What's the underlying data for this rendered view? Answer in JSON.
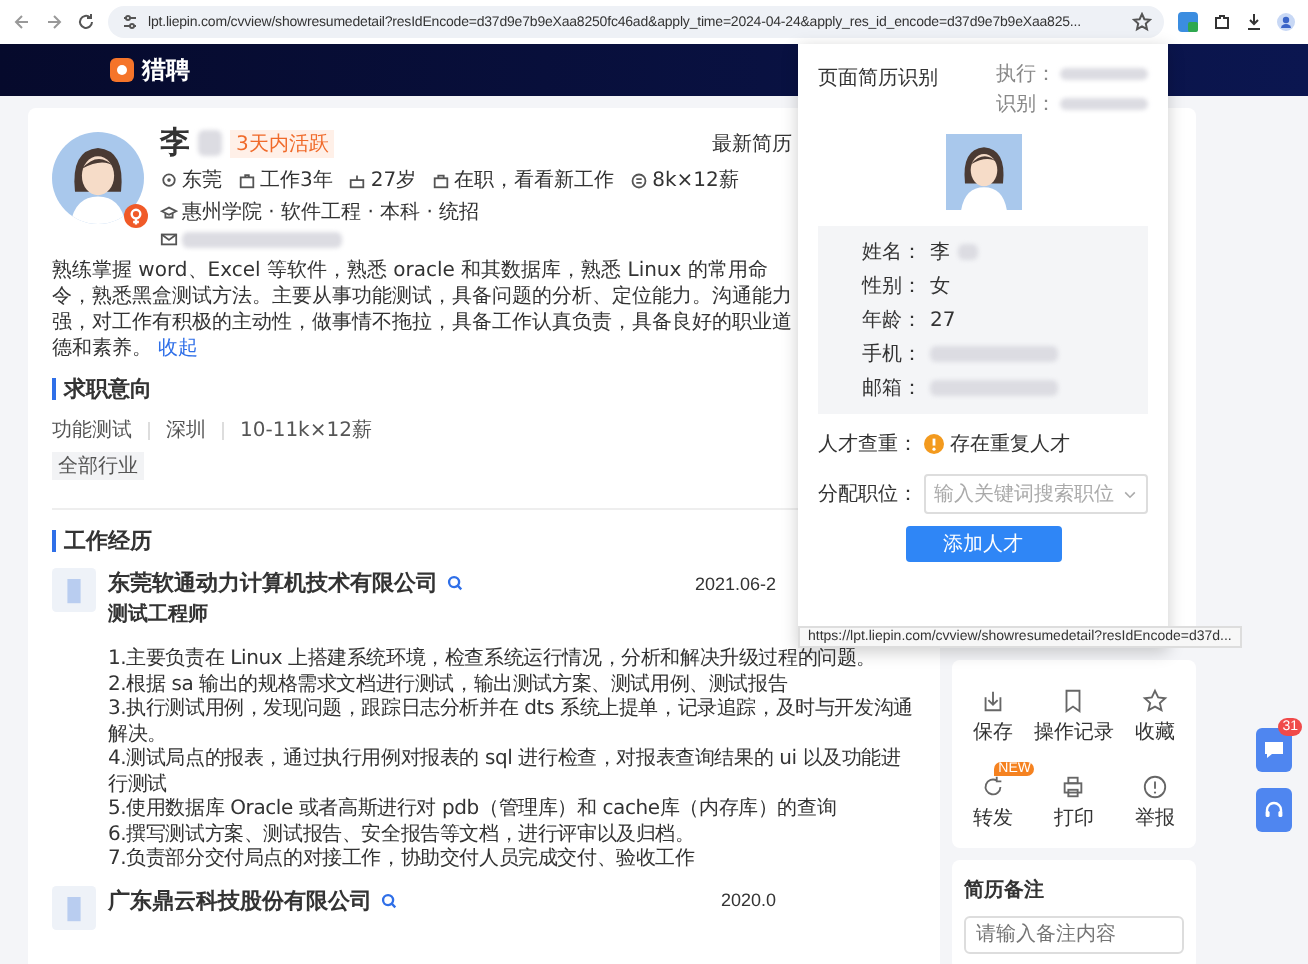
{
  "browser": {
    "url": "lpt.liepin.com/cvview/showresumedetail?resIdEncode=d37d9e7b9eXaa8250fc46ad&apply_time=2024-04-24&apply_res_id_encode=d37d9e7b9eXaa825..."
  },
  "nav": {
    "logo": "猎聘"
  },
  "profile": {
    "name": "李",
    "active_badge": "3天内活跃",
    "updated": "最新简历",
    "facts": [
      {
        "kind": "location",
        "text": "东莞"
      },
      {
        "kind": "work",
        "text": "工作3年"
      },
      {
        "kind": "age",
        "text": "27岁"
      },
      {
        "kind": "status",
        "text": "在职，看看新工作"
      },
      {
        "kind": "salary",
        "text": "8k×12薪"
      }
    ],
    "education": "惠州学院 · 软件工程 · 本科 · 统招",
    "summary": "熟练掌握 word、Excel 等软件，熟悉 oracle 和其数据库，熟悉 Linux 的常用命令，熟悉黑盒测试方法。主要从事功能测试，具备问题的分析、定位能力。沟通能力强，对工作有积极的主动性，做事情不拖拉，具备工作认真负责，具备良好的职业道德和素养。",
    "collapse_link": "收起"
  },
  "job_intent": {
    "heading": "求职意向",
    "items": [
      "功能测试",
      "深圳",
      "10-11k×12薪"
    ],
    "tag": "全部行业"
  },
  "experience": {
    "heading": "工作经历",
    "jobs": [
      {
        "company": "东莞软通动力计算机技术有限公司",
        "title": "测试工程师",
        "date": "2021.06-2",
        "duties": [
          "1.主要负责在 Linux 上搭建系统环境，检查系统运行情况，分析和解决升级过程的问题。",
          "2.根据 sa 输出的规格需求文档进行测试，输出测试方案、测试用例、测试报告",
          "3.执行测试用例，发现问题，跟踪日志分析并在 dts 系统上提单，记录追踪，及时与开发沟通解决。",
          "4.测试局点的报表，通过执行用例对报表的 sql 进行检查，对报表查询结果的 ui 以及功能进行测试",
          "5.使用数据库 Oracle 或者高斯进行对 pdb（管理库）和 cache库（内存库）的查询",
          "6.撰写测试方案、测试报告、安全报告等文档，进行评审以及归档。",
          "7.负责部分交付局点的对接工作，协助交付人员完成交付、验收工作"
        ]
      },
      {
        "company": "广东鼎云科技股份有限公司",
        "date": "2020.0"
      }
    ]
  },
  "sidebar": {
    "actions": [
      {
        "kind": "save",
        "label": "保存"
      },
      {
        "kind": "record",
        "label": "操作记录"
      },
      {
        "kind": "star",
        "label": "收藏"
      },
      {
        "kind": "share",
        "label": "转发",
        "badge": "NEW"
      },
      {
        "kind": "print",
        "label": "打印"
      },
      {
        "kind": "report",
        "label": "举报"
      }
    ],
    "notes": {
      "heading": "简历备注",
      "placeholder": "请输入备注内容"
    }
  },
  "popup": {
    "title": "页面简历识别",
    "meta": [
      "执行：",
      "识别："
    ],
    "fields": [
      {
        "label": "姓名：",
        "value": "李",
        "blurred": true
      },
      {
        "label": "性别：",
        "value": "女",
        "blurred": false
      },
      {
        "label": "年龄：",
        "value": "27",
        "blurred": false
      },
      {
        "label": "手机：",
        "blurred": true
      },
      {
        "label": "邮箱：",
        "blurred": true
      }
    ],
    "duplicate_label": "人才查重：",
    "duplicate_status": "存在重复人才",
    "assign_label": "分配职位：",
    "assign_placeholder": "输入关键词搜索职位",
    "add_button": "添加人才",
    "status_url": "https://lpt.liepin.com/cvview/showresumedetail?resIdEncode=d37d..."
  },
  "float_buttons": {
    "chat_badge": "31"
  }
}
